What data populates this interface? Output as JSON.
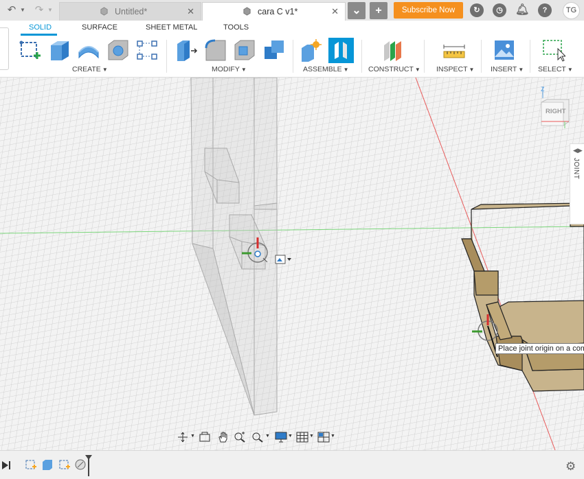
{
  "titlebar": {
    "tabs": [
      {
        "label": "Untitled*",
        "active": false
      },
      {
        "label": "cara C v1*",
        "active": true
      }
    ],
    "subscribe_label": "Subscribe Now",
    "user_initials": "TG"
  },
  "ribbon": {
    "tabs": [
      "SOLID",
      "SURFACE",
      "SHEET METAL",
      "TOOLS"
    ],
    "groups": {
      "create": "CREATE",
      "modify": "MODIFY",
      "assemble": "ASSEMBLE",
      "construct": "CONSTRUCT",
      "inspect": "INSPECT",
      "insert": "INSERT",
      "select": "SELECT"
    }
  },
  "viewport": {
    "viewcube_face": "RIGHT",
    "viewcube_axis": "Z",
    "side_panel_label": "JOINT",
    "tooltip": "Place joint origin on a comp"
  },
  "colors": {
    "accent": "#0696d7",
    "subscribe": "#f5901e",
    "wood_top": "#c8b48c",
    "wood_side": "#b59c6a"
  }
}
